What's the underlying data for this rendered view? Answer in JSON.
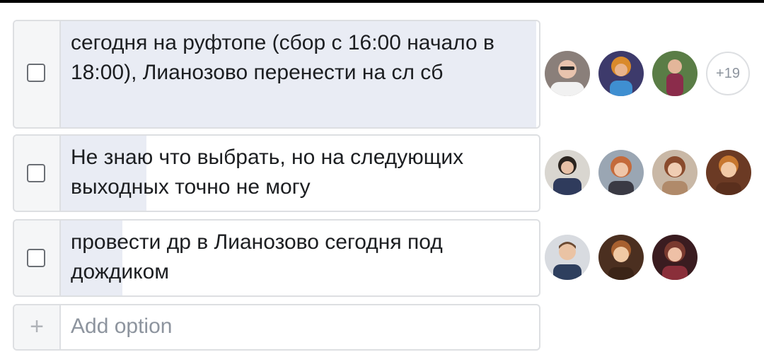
{
  "poll": {
    "options": [
      {
        "label": "сегодня на руфтопе (сбор с 16:00 начало в 18:00), Лианозово перенести на сл сб",
        "checked": true,
        "vote_fraction": 1.0,
        "voters": [
          {
            "avatar_color": "#8a7f7a"
          },
          {
            "avatar_color": "#c0722f"
          },
          {
            "avatar_color": "#4c6b3f"
          }
        ],
        "more_count": "+19"
      },
      {
        "label": "Не знаю что выбрать, но на следующих выходных точно не могу",
        "checked": false,
        "vote_fraction": 0.18,
        "voters": [
          {
            "avatar_color": "#3d4a6a"
          },
          {
            "avatar_color": "#c4876a"
          },
          {
            "avatar_color": "#9b6e57"
          },
          {
            "avatar_color": "#c99a73"
          }
        ]
      },
      {
        "label": "провести др в Лианозово сегодня под дождиком",
        "checked": false,
        "vote_fraction": 0.13,
        "voters": [
          {
            "avatar_color": "#6f7f95"
          },
          {
            "avatar_color": "#a26d46"
          },
          {
            "avatar_color": "#7a3a3a"
          }
        ]
      }
    ],
    "add_option": {
      "placeholder": "Add option",
      "icon": "plus-icon"
    }
  },
  "colors": {
    "accent": "#1877f2",
    "border": "#dddfe2",
    "vote_fill": "#e9ecf4"
  }
}
